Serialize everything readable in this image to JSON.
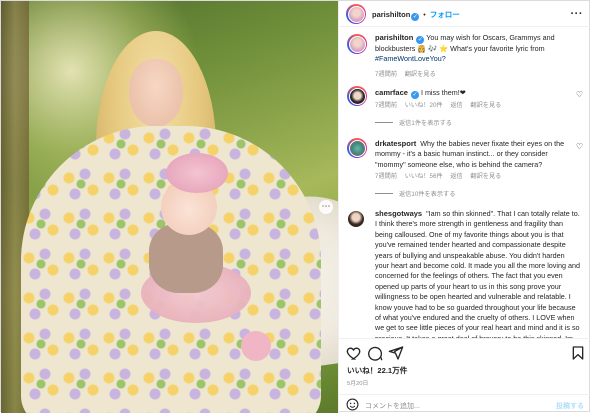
{
  "colors": {
    "link": "#0095f6",
    "verified": "#3897f0",
    "muted": "#8e8e8e",
    "text": "#262626",
    "border": "#dbdbdb"
  },
  "photo": {
    "alt": "Mother in floral dress holding baby with pink bow"
  },
  "header": {
    "username": "parishilton",
    "follow_label": "フォロー",
    "more_label": "···",
    "separator": "•"
  },
  "caption": {
    "username": "parishilton",
    "text": "You may wish for Oscars, Grammys and blockbusters 👸 🎶 ⭐ What's your favorite lyric from",
    "hashtag": "#FameWontLoveYou?",
    "time": "7週間前",
    "translate": "翻訳を見る"
  },
  "comments": [
    {
      "username": "camrface",
      "text": "I miss them!❤",
      "time": "7週間前",
      "likes": "いいね！20件",
      "reply": "返信",
      "translate": "翻訳を見る",
      "view_replies": "返信1件を表示する"
    },
    {
      "username": "drkatesport",
      "text": "Why the babies never fixate their eyes on the mommy - it's a basic human instinct... or they consider \"mommy\" someone else, who is behind the camera?",
      "time": "7週間前",
      "likes": "いいね！56件",
      "reply": "返信",
      "translate": "翻訳を見る",
      "view_replies": "返信10件を表示する"
    },
    {
      "username": "shesgotways",
      "text": "\"Iam so thin skinned\". That I can totally relate to. I think there's more strength in gentleness and fragility than being calloused. One of my favorite things about you is that you've remained tender hearted and compassionate despite years of bullying and unspeakable abuse. You didn't harden your heart and become cold. It made you all the more loving and concerned for the feelings of others. The fact that you even opened up parts of your heart to us in this song prove your willingness to be open hearted and vulnerable and relatable. I know youve had to be so guarded throughout your life because of what you've endured and the cruelty of others. I LOVE when we get to see little pieces of your real heart and mind and it is so precious. It takes a great deal of bravery to be this skinned. Im really proud of who you are 💖"
    }
  ],
  "actions": {
    "like_icon": "heart-outline-icon",
    "comment_icon": "comment-bubble-icon",
    "share_icon": "paper-plane-icon",
    "save_icon": "bookmark-icon",
    "likes": "いいね！22.1万件",
    "date": "5月20日"
  },
  "add_comment": {
    "emoji_icon": "smiley-icon",
    "placeholder": "コメントを追加...",
    "post_label": "投稿する"
  }
}
